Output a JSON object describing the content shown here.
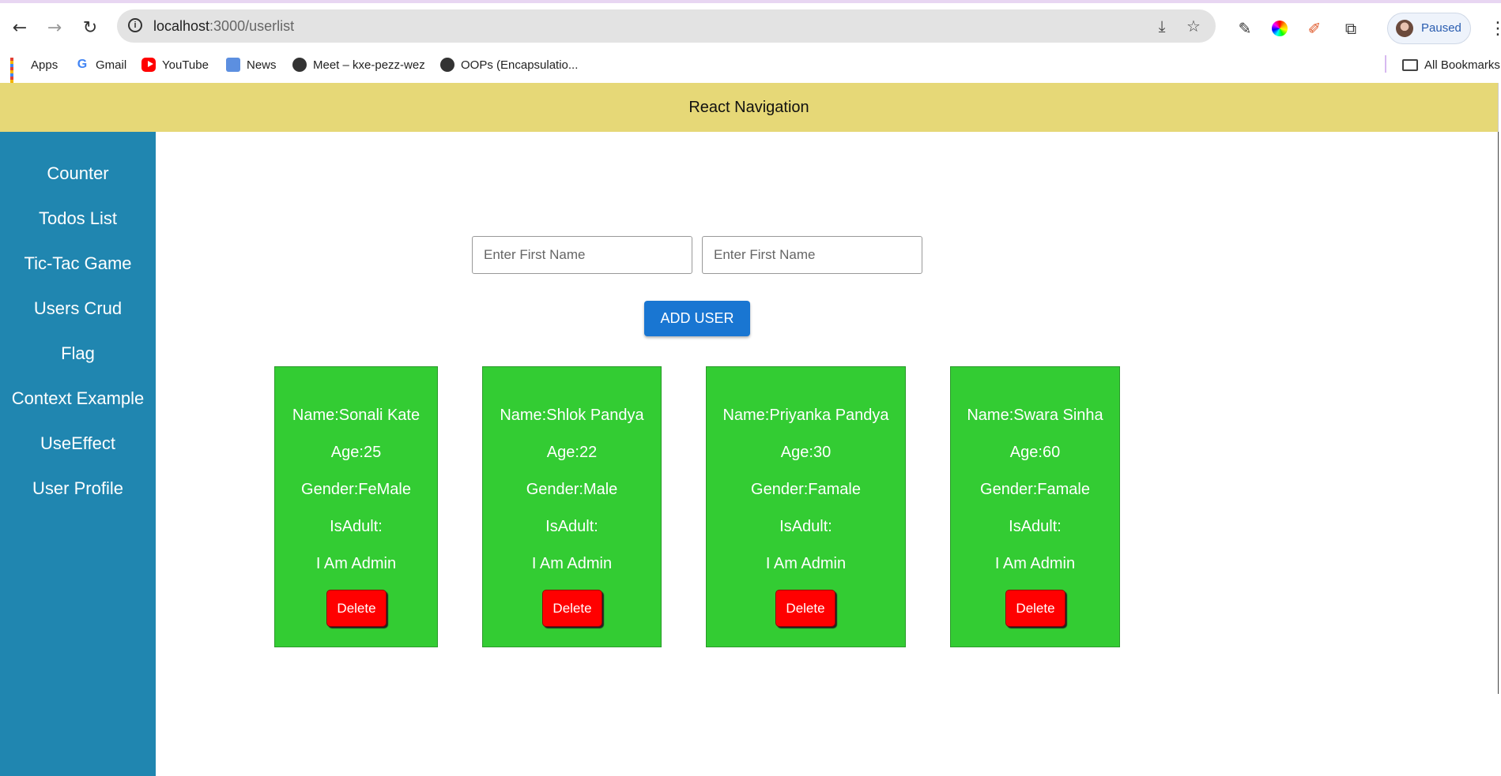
{
  "browser": {
    "url_host": "localhost",
    "url_path": ":3000/userlist",
    "profile_label": "Paused",
    "bookmarks": [
      {
        "label": "Apps",
        "icon": "apps-grid-icon"
      },
      {
        "label": "Gmail",
        "icon": "google-icon"
      },
      {
        "label": "YouTube",
        "icon": "youtube-icon"
      },
      {
        "label": "News",
        "icon": "news-icon"
      },
      {
        "label": "Meet – kxe-pezz-wez",
        "icon": "globe-icon"
      },
      {
        "label": "OOPs (Encapsulatio...",
        "icon": "globe-icon"
      }
    ],
    "all_bookmarks_label": "All Bookmarks"
  },
  "header": {
    "title": "React Navigation"
  },
  "sidebar": {
    "items": [
      {
        "label": "Counter"
      },
      {
        "label": "Todos List"
      },
      {
        "label": "Tic-Tac Game"
      },
      {
        "label": "Users Crud"
      },
      {
        "label": "Flag"
      },
      {
        "label": "Context Example"
      },
      {
        "label": "UseEffect"
      },
      {
        "label": "User Profile"
      }
    ]
  },
  "form": {
    "first_placeholder": "Enter First Name",
    "second_placeholder": "Enter First Name",
    "add_label": "ADD USER"
  },
  "users": [
    {
      "name": "Name:Sonali Kate",
      "age": "Age:25",
      "gender": "Gender:FeMale",
      "adult": "IsAdult:",
      "role": "I Am Admin",
      "delete": "Delete"
    },
    {
      "name": "Name:Shlok Pandya",
      "age": "Age:22",
      "gender": "Gender:Male",
      "adult": "IsAdult:",
      "role": "I Am Admin",
      "delete": "Delete"
    },
    {
      "name": "Name:Priyanka Pandya",
      "age": "Age:30",
      "gender": "Gender:Famale",
      "adult": "IsAdult:",
      "role": "I Am Admin",
      "delete": "Delete"
    },
    {
      "name": "Name:Swara Sinha",
      "age": "Age:60",
      "gender": "Gender:Famale",
      "adult": "IsAdult:",
      "role": "I Am Admin",
      "delete": "Delete"
    }
  ],
  "colors": {
    "header_bg": "#e6d877",
    "sidebar_bg": "#2086b0",
    "card_bg": "#33cc33",
    "add_button": "#1976d2",
    "delete_button": "#ff0000"
  }
}
